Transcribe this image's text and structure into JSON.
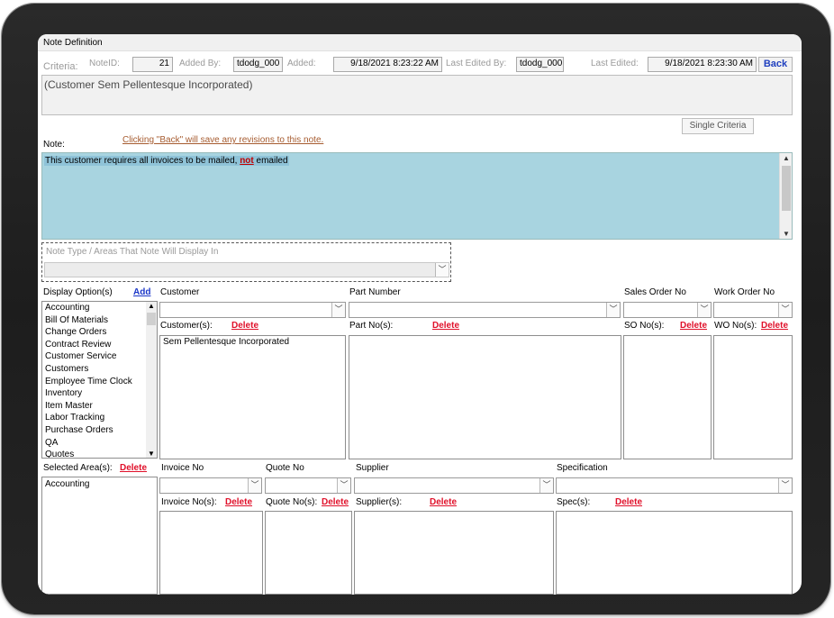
{
  "window": {
    "title": "Note Definition"
  },
  "header": {
    "criteria_label": "Criteria:",
    "note_id_label": "NoteID:",
    "note_id_value": "21",
    "added_by_label": "Added By:",
    "added_by_value": "tdodg_000",
    "added_label": "Added:",
    "added_value": "9/18/2021 8:23:22 AM",
    "last_edited_by_label": "Last Edited By:",
    "last_edited_by_value": "tdodg_000",
    "last_edited_label": "Last Edited:",
    "last_edited_value": "9/18/2021 8:23:30 AM",
    "back_label": "Back"
  },
  "criteria_text": "(Customer Sem Pellentesque Incorporated)",
  "single_criteria_label": "Single Criteria",
  "note": {
    "label": "Note:",
    "save_hint": "Clicking \"Back\" will save any revisions to this note.",
    "text_part1": "This customer requires all invoices to be mailed, ",
    "text_emph": "not",
    "text_part2": " emailed"
  },
  "note_type": {
    "label": "Note Type / Areas That Note Will Display In",
    "value": ""
  },
  "display_options": {
    "label": "Display Option(s)",
    "add_label": "Add",
    "items": [
      "Accounting",
      "Bill Of Materials",
      "Change Orders",
      "Contract Review",
      "Customer Service",
      "Customers",
      "Employee Time Clock",
      "Inventory",
      "Item Master",
      "Labor Tracking",
      "Purchase Orders",
      "QA",
      "Quotes"
    ]
  },
  "selected_areas": {
    "label": "Selected Area(s):",
    "delete_label": "Delete",
    "items": [
      "Accounting"
    ]
  },
  "customer": {
    "label": "Customer",
    "list_label": "Customer(s):",
    "delete_label": "Delete",
    "items": [
      "Sem Pellentesque Incorporated"
    ]
  },
  "part_number": {
    "label": "Part Number",
    "list_label": "Part No(s):",
    "delete_label": "Delete"
  },
  "sales_order": {
    "label": "Sales Order No",
    "list_label": "SO No(s):",
    "delete_label": "Delete"
  },
  "work_order": {
    "label": "Work Order No",
    "list_label": "WO No(s):",
    "delete_label": "Delete"
  },
  "invoice": {
    "label": "Invoice No",
    "list_label": "Invoice No(s):",
    "delete_label": "Delete"
  },
  "quote": {
    "label": "Quote No",
    "list_label": "Quote No(s):",
    "delete_label": "Delete"
  },
  "supplier": {
    "label": "Supplier",
    "list_label": "Supplier(s):",
    "delete_label": "Delete"
  },
  "specification": {
    "label": "Specification",
    "list_label": "Spec(s):",
    "delete_label": "Delete"
  },
  "icons": {
    "dropdown": "chevron-down-icon",
    "scroll_up": "caret-up-icon",
    "scroll_down": "caret-down-icon"
  }
}
